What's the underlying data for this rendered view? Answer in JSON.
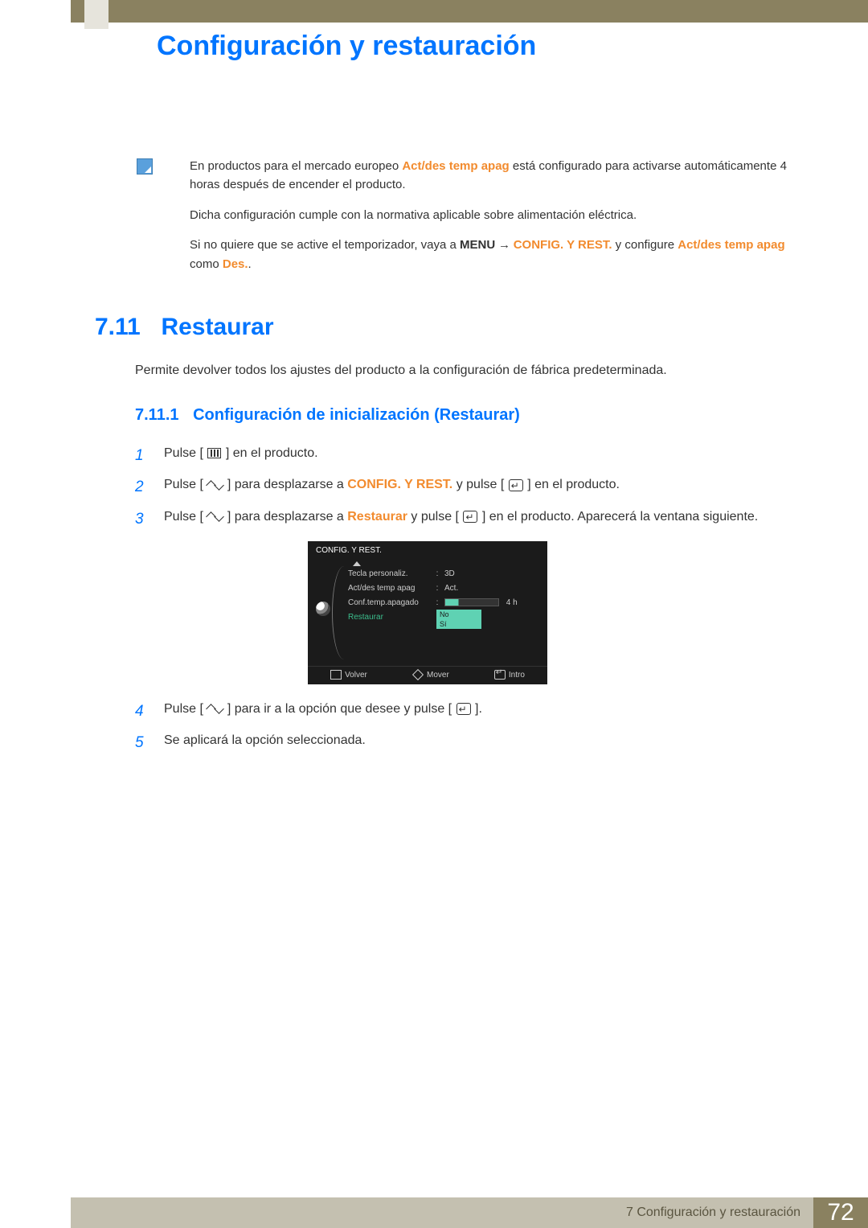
{
  "page_title": "Configuración y restauración",
  "note": {
    "p1_a": "En productos para el mercado europeo ",
    "p1_b": "Act/des temp apag",
    "p1_c": " está configurado para activarse automáticamente 4 horas después de encender el producto.",
    "p2": "Dicha configuración cumple con la normativa aplicable sobre alimentación eléctrica.",
    "p3_a": "Si no quiere que se active el temporizador, vaya a ",
    "p3_menu": "MENU",
    "p3_arrow": " → ",
    "p3_b": "CONFIG. Y REST.",
    "p3_c": " y configure ",
    "p3_d": "Act/des temp apag",
    "p3_e": " como ",
    "p3_f": "Des.",
    "p3_g": "."
  },
  "h2": {
    "num": "7.11",
    "txt": "Restaurar"
  },
  "intro": "Permite devolver todos los ajustes del producto a la configuración de fábrica predeterminada.",
  "h3": {
    "num": "7.11.1",
    "txt": "Configuración de inicialización (Restaurar)"
  },
  "steps": {
    "s1": {
      "num": "1",
      "a": "Pulse [",
      "b": "] en el producto."
    },
    "s2": {
      "num": "2",
      "a": "Pulse [",
      "b": "] para desplazarse a ",
      "c": "CONFIG. Y REST.",
      "d": " y pulse [",
      "e": "] en el producto."
    },
    "s3": {
      "num": "3",
      "a": "Pulse [",
      "b": "] para desplazarse a ",
      "c": "Restaurar",
      "d": " y pulse [",
      "e": "] en el producto. Aparecerá la ventana siguiente."
    },
    "s4": {
      "num": "4",
      "a": "Pulse [",
      "b": "] para ir a la opción que desee y pulse [",
      "c": "]."
    },
    "s5": {
      "num": "5",
      "a": "Se aplicará la opción seleccionada."
    }
  },
  "osd": {
    "title": "CONFIG. Y REST.",
    "rows": {
      "r1": {
        "label": "Tecla personaliz.",
        "value": "3D"
      },
      "r2": {
        "label": "Act/des temp apag",
        "value": "Act."
      },
      "r3": {
        "label": "Conf.temp.apagado",
        "value": "4 h"
      },
      "r4": {
        "label": "Restaurar"
      }
    },
    "dropdown": {
      "opt1": "No",
      "opt2": "Sí"
    },
    "footer": {
      "back": "Volver",
      "move": "Mover",
      "enter": "Intro"
    }
  },
  "footer": {
    "chapter": "7 Configuración y restauración",
    "page": "72"
  }
}
